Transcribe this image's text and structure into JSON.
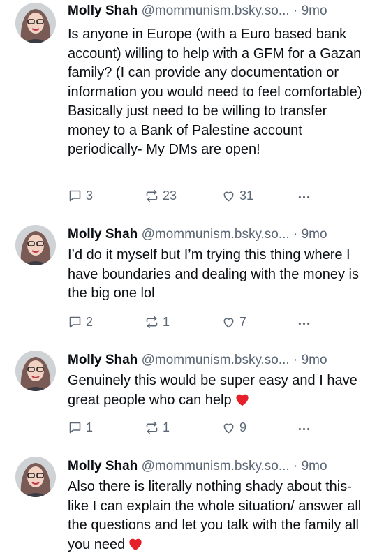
{
  "colors": {
    "text": "#0b0f14",
    "muted": "#5b6775",
    "heart": "#e5202a"
  },
  "posts": [
    {
      "author": "Molly Shah",
      "handle": "@mommunism.bsky.so...",
      "separator": "·",
      "time": "9mo",
      "text": "Is anyone in Europe (with a Euro based bank account) willing to help with a GFM for a Gazan family? (I can provide any documentation or information you would need to feel comfortable) Basically just need to be willing to transfer money to a Bank of Palestine account periodically- My DMs are open!",
      "replies": "3",
      "reposts": "23",
      "likes": "31"
    },
    {
      "author": "Molly Shah",
      "handle": "@mommunism.bsky.so...",
      "separator": "·",
      "time": "9mo",
      "text": "I’d do it myself but I’m trying this thing where I have boundaries and dealing with the money is the big one lol",
      "replies": "2",
      "reposts": "1",
      "likes": "7"
    },
    {
      "author": "Molly Shah",
      "handle": "@mommunism.bsky.so...",
      "separator": "·",
      "time": "9mo",
      "text": "Genuinely this would be super easy and I have great people who can help",
      "emoji": "red-heart",
      "replies": "1",
      "reposts": "1",
      "likes": "9"
    },
    {
      "author": "Molly Shah",
      "handle": "@mommunism.bsky.so...",
      "separator": "·",
      "time": "9mo",
      "text": "Also there is literally nothing shady about this- like I can explain the whole situation/ answer all the questions and let you talk with the family all you need",
      "emoji": "red-heart"
    }
  ]
}
